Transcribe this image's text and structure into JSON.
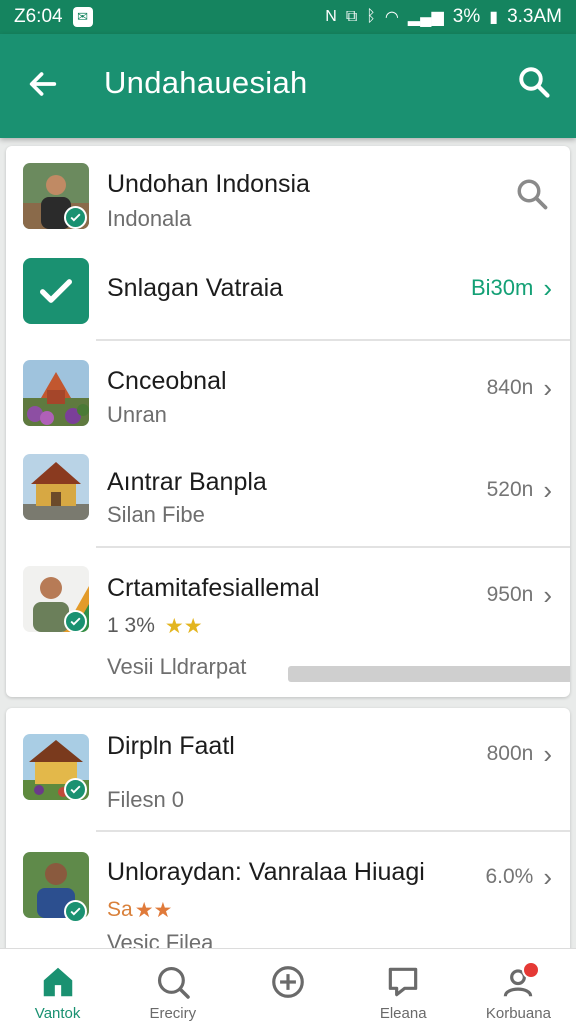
{
  "status": {
    "time": "Z6:04",
    "battery": "3%",
    "clock": "3.3AM"
  },
  "app_bar": {
    "title": "Undahauesiah"
  },
  "header_item": {
    "title": "Undohan Indonsia",
    "subtitle": "Indonala"
  },
  "selected_item": {
    "title": "Snlagan Vatraia",
    "meta": "Bi30m"
  },
  "list": [
    {
      "title": "Cnceobnal",
      "subtitle": "Unran",
      "meta": "840n"
    },
    {
      "title": "Aıntrar Banpla",
      "subtitle": "Silan Fibe",
      "meta": "520n"
    },
    {
      "title": "Crtamitafesiallemal",
      "rating": "1 3%",
      "stars": "★★",
      "subtitle": "Vesii Lldrarpat",
      "meta": "950n"
    }
  ],
  "list2": [
    {
      "title": "Dirpln Faatl",
      "subtitle": "Filesn 0",
      "meta": "800n"
    },
    {
      "title": "Unloraydan: Vanralaa Hiuagi",
      "rating": "Sa",
      "stars": "★★",
      "subtitle": "Vesic Filea",
      "meta": "6.0%"
    }
  ],
  "nav": [
    "Vantok",
    "Ereciry",
    "",
    "Eleana",
    "Korbuana"
  ],
  "colors": {
    "primary": "#1a9171",
    "status_bar": "#15845f",
    "accent": "#13a075"
  }
}
